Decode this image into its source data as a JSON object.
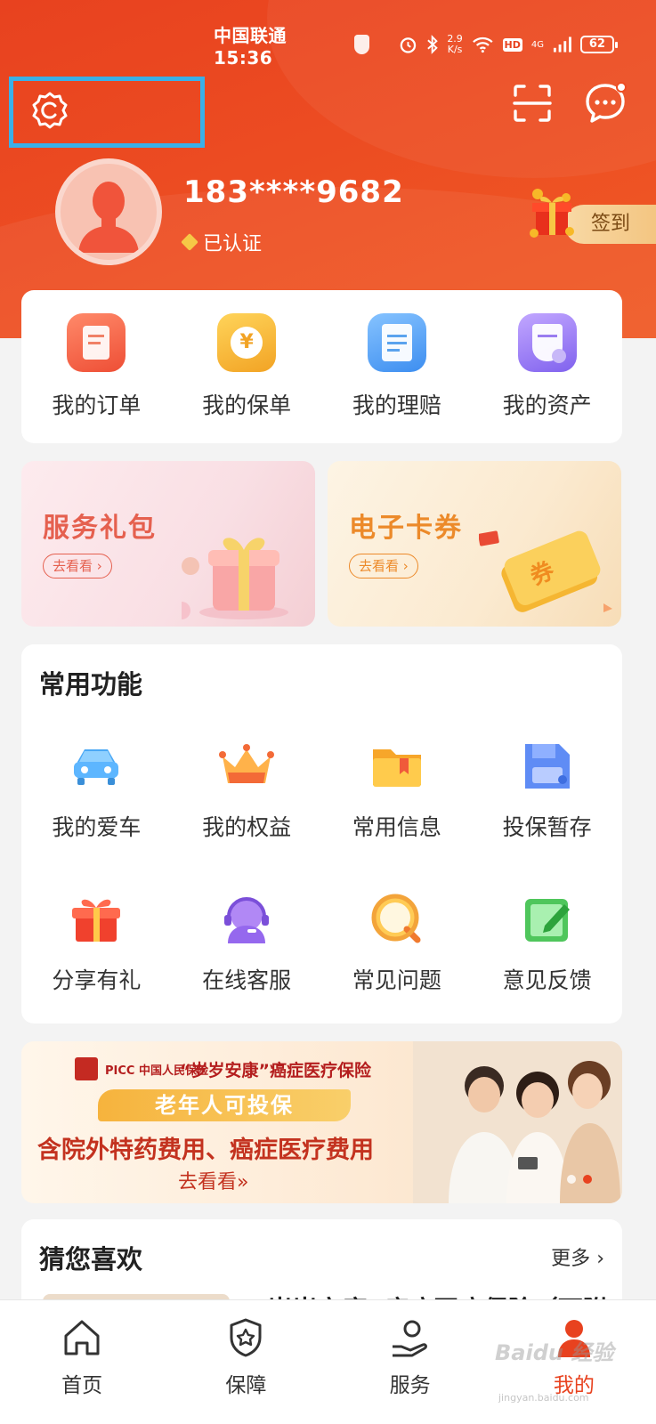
{
  "status_bar": {
    "carrier_time": "中国联通 15:36",
    "speed_value": "2.9",
    "speed_unit": "K/s",
    "hd": "HD",
    "network": "4G",
    "battery": "62"
  },
  "header": {
    "phone": "183****9682",
    "verified": "已认证",
    "checkin": "签到"
  },
  "quick_menu": [
    {
      "label": "我的订单",
      "icon": "order-icon",
      "color": "#f2674a"
    },
    {
      "label": "我的保单",
      "icon": "policy-icon",
      "color": "#f4b637"
    },
    {
      "label": "我的理赔",
      "icon": "claim-icon",
      "color": "#5aa3ee"
    },
    {
      "label": "我的资产",
      "icon": "asset-icon",
      "color": "#9a7cf0"
    }
  ],
  "promos": [
    {
      "title": "服务礼包",
      "button": "去看看 ›",
      "color": "#e5604f"
    },
    {
      "title": "电子卡券",
      "button": "去看看 ›",
      "color": "#ec8a2a"
    }
  ],
  "common_functions": {
    "title": "常用功能",
    "items": [
      {
        "label": "我的爱车",
        "icon": "car-icon"
      },
      {
        "label": "我的权益",
        "icon": "crown-icon"
      },
      {
        "label": "常用信息",
        "icon": "folder-icon"
      },
      {
        "label": "投保暂存",
        "icon": "save-icon"
      },
      {
        "label": "分享有礼",
        "icon": "gift-icon"
      },
      {
        "label": "在线客服",
        "icon": "customer-service-icon"
      },
      {
        "label": "常见问题",
        "icon": "faq-icon"
      },
      {
        "label": "意见反馈",
        "icon": "feedback-icon"
      }
    ]
  },
  "banner": {
    "brand": "PICC 中国人民保险",
    "product": "“岁岁安康”癌症医疗保险",
    "tag": "老年人可投保",
    "headline": "含院外特药费用、癌症医疗费用",
    "cta": "去看看»"
  },
  "recommend": {
    "title": "猜您喜欢",
    "more": "更多",
    "first_item_partial": "“岁岁安康”癌症医疗保险（可附"
  },
  "tabbar": [
    {
      "label": "首页",
      "icon": "home-icon"
    },
    {
      "label": "保障",
      "icon": "shield-star-icon"
    },
    {
      "label": "服务",
      "icon": "service-hand-icon"
    },
    {
      "label": "我的",
      "icon": "profile-icon"
    }
  ],
  "watermark": {
    "logo": "Baidu 经验",
    "url": "jingyan.baidu.com"
  },
  "colors": {
    "brand": "#e8421f",
    "highlight_box": "#3ab0e8"
  }
}
